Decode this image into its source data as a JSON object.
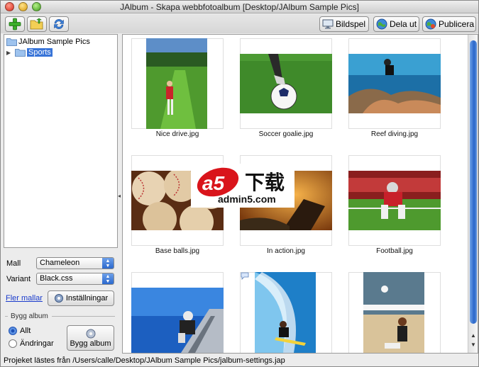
{
  "window": {
    "title": "JAlbum - Skapa webbfotoalbum [Desktop/JAlbum Sample Pics]"
  },
  "toolbar": {
    "add_icon": "add-plus-icon",
    "open_icon": "open-folder-icon",
    "refresh_icon": "refresh-arrows-icon",
    "slideshow_label": "Bildspel",
    "share_label": "Dela ut",
    "publish_label": "Publicera"
  },
  "tree": {
    "root_label": "JAlbum Sample Pics",
    "child_label": "Sports"
  },
  "thumbnails": [
    {
      "caption": "Nice drive.jpg"
    },
    {
      "caption": "Soccer goalie.jpg"
    },
    {
      "caption": "Reef diving.jpg"
    },
    {
      "caption": "Base balls.jpg"
    },
    {
      "caption": "In action.jpg"
    },
    {
      "caption": "Football.jpg"
    },
    {
      "caption": ""
    },
    {
      "caption": ""
    },
    {
      "caption": ""
    }
  ],
  "settings": {
    "template_label": "Mall",
    "template_value": "Chameleon",
    "variant_label": "Variant",
    "variant_value": "Black.css",
    "more_templates_link": "Fler mallar",
    "settings_button": "Inställningar",
    "build_group_label": "Bygg album",
    "radio_all": "Allt",
    "radio_changes": "Ändringar",
    "build_button": "Bygg album",
    "radio_selected": "all"
  },
  "watermark": {
    "brand": "a5",
    "cn": "下载",
    "url": "admin5.com"
  },
  "status": {
    "text": "Projeket lästes från /Users/calle/Desktop/JAlbum Sample Pics/jalbum-settings.jap"
  }
}
